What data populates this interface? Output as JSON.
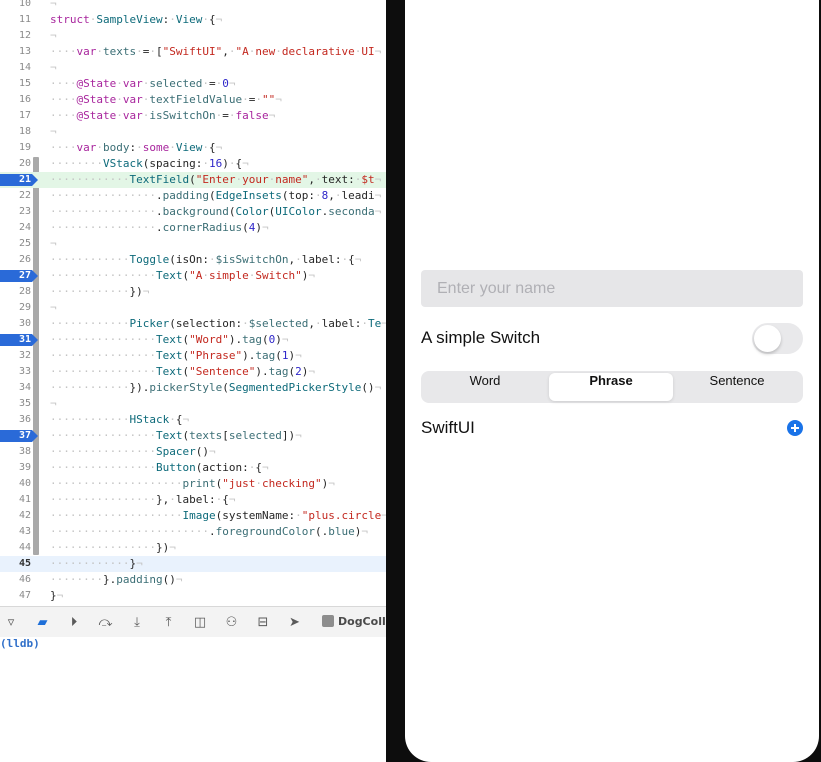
{
  "editor": {
    "lines": [
      {
        "n": "10",
        "code": "",
        "gutter": false,
        "bp": false,
        "hl": ""
      },
      {
        "n": "11",
        "code": "[[kw:struct]]·[[ty:SampleView]]:·[[ty:View]]·{",
        "gutter": false,
        "bp": false,
        "hl": ""
      },
      {
        "n": "12",
        "code": "",
        "gutter": false,
        "bp": false,
        "hl": ""
      },
      {
        "n": "13",
        "code": "····[[kw:var]]·[[fn:texts]]·=·[[[st:\"SwiftUI\"]],·[[st:\"A·new·declarative·UI]]",
        "gutter": false,
        "bp": false,
        "hl": ""
      },
      {
        "n": "14",
        "code": "",
        "gutter": false,
        "bp": false,
        "hl": ""
      },
      {
        "n": "15",
        "code": "····[[kw:@State]]·[[kw:var]]·[[fn:selected]]·=·[[nm:0]]",
        "gutter": false,
        "bp": false,
        "hl": ""
      },
      {
        "n": "16",
        "code": "····[[kw:@State]]·[[kw:var]]·[[fn:textFieldValue]]·=·[[st:\"\"]]",
        "gutter": false,
        "bp": false,
        "hl": ""
      },
      {
        "n": "17",
        "code": "····[[kw:@State]]·[[kw:var]]·[[fn:isSwitchOn]]·=·[[kw:false]]",
        "gutter": false,
        "bp": false,
        "hl": ""
      },
      {
        "n": "18",
        "code": "",
        "gutter": false,
        "bp": false,
        "hl": ""
      },
      {
        "n": "19",
        "code": "····[[kw:var]]·[[fn:body]]:·[[kw:some]]·[[ty:View]]·{",
        "gutter": false,
        "bp": false,
        "hl": ""
      },
      {
        "n": "20",
        "code": "········[[ty:VStack]](spacing:·[[nm:16]])·{",
        "gutter": true,
        "bp": false,
        "hl": ""
      },
      {
        "n": "21",
        "code": "············[[ty:TextField]]([[st:\"Enter·your·name\"]],·text:·[[st:$t]]",
        "gutter": true,
        "bp": true,
        "hl": "sel"
      },
      {
        "n": "22",
        "code": "················.[[fn:padding]]([[ty:EdgeInsets]](top:·[[nm:8]],·leadi",
        "gutter": true,
        "bp": false,
        "hl": ""
      },
      {
        "n": "23",
        "code": "················.[[fn:background]]([[ty:Color]]([[ty:UIColor]].[[fn:seconda]]",
        "gutter": true,
        "bp": false,
        "hl": ""
      },
      {
        "n": "24",
        "code": "················.[[fn:cornerRadius]]([[nm:4]])",
        "gutter": true,
        "bp": false,
        "hl": ""
      },
      {
        "n": "25",
        "code": "",
        "gutter": true,
        "bp": false,
        "hl": ""
      },
      {
        "n": "26",
        "code": "············[[ty:Toggle]](isOn:·[[fn:$isSwitchOn]],·label:·{",
        "gutter": true,
        "bp": false,
        "hl": ""
      },
      {
        "n": "27",
        "code": "················[[ty:Text]]([[st:\"A·simple·Switch\"]])",
        "gutter": true,
        "bp": true,
        "hl": ""
      },
      {
        "n": "28",
        "code": "············})",
        "gutter": true,
        "bp": false,
        "hl": ""
      },
      {
        "n": "29",
        "code": "",
        "gutter": true,
        "bp": false,
        "hl": ""
      },
      {
        "n": "30",
        "code": "············[[ty:Picker]](selection:·[[fn:$selected]],·label:·[[ty:Te]]",
        "gutter": true,
        "bp": false,
        "hl": ""
      },
      {
        "n": "31",
        "code": "················[[ty:Text]]([[st:\"Word\"]]).[[fn:tag]]([[nm:0]])",
        "gutter": true,
        "bp": true,
        "hl": ""
      },
      {
        "n": "32",
        "code": "················[[ty:Text]]([[st:\"Phrase\"]]).[[fn:tag]]([[nm:1]])",
        "gutter": true,
        "bp": false,
        "hl": ""
      },
      {
        "n": "33",
        "code": "················[[ty:Text]]([[st:\"Sentence\"]]).[[fn:tag]]([[nm:2]])",
        "gutter": true,
        "bp": false,
        "hl": ""
      },
      {
        "n": "34",
        "code": "············}).[[fn:pickerStyle]]([[ty:SegmentedPickerStyle]]()",
        "gutter": true,
        "bp": false,
        "hl": ""
      },
      {
        "n": "35",
        "code": "",
        "gutter": true,
        "bp": false,
        "hl": ""
      },
      {
        "n": "36",
        "code": "············[[ty:HStack]]·{",
        "gutter": true,
        "bp": false,
        "hl": ""
      },
      {
        "n": "37",
        "code": "················[[ty:Text]]([[fn:texts]][[[fn:selected]]])",
        "gutter": true,
        "bp": true,
        "hl": ""
      },
      {
        "n": "38",
        "code": "················[[ty:Spacer]]()",
        "gutter": true,
        "bp": false,
        "hl": ""
      },
      {
        "n": "39",
        "code": "················[[ty:Button]](action:·{",
        "gutter": true,
        "bp": false,
        "hl": ""
      },
      {
        "n": "40",
        "code": "····················[[fn:print]]([[st:\"just·checking\"]])",
        "gutter": true,
        "bp": false,
        "hl": ""
      },
      {
        "n": "41",
        "code": "················},·label:·{",
        "gutter": true,
        "bp": false,
        "hl": ""
      },
      {
        "n": "42",
        "code": "····················[[ty:Image]](systemName:·[[st:\"plus.circle]]",
        "gutter": true,
        "bp": false,
        "hl": ""
      },
      {
        "n": "43",
        "code": "························.[[fn:foregroundColor]](.[[fn:blue]])",
        "gutter": true,
        "bp": false,
        "hl": ""
      },
      {
        "n": "44",
        "code": "················})",
        "gutter": true,
        "bp": false,
        "hl": ""
      },
      {
        "n": "45",
        "code": "············}",
        "gutter": false,
        "bp": false,
        "hl": "cur"
      },
      {
        "n": "46",
        "code": "········}.[[fn:padding]]()",
        "gutter": false,
        "bp": false,
        "hl": ""
      },
      {
        "n": "47",
        "code": "}",
        "gutter": false,
        "bp": false,
        "hl": ""
      }
    ]
  },
  "debug_toolbar": {
    "buttons": [
      {
        "name": "hide-console-button",
        "icon": "▿",
        "active": false
      },
      {
        "name": "breakpoints-toggle-button",
        "icon": "▰",
        "active": true
      },
      {
        "name": "continue-button",
        "icon": "⏵",
        "active": false
      },
      {
        "name": "step-over-button",
        "icon": "⤼",
        "active": false
      },
      {
        "name": "step-into-button",
        "icon": "⤓",
        "active": false
      },
      {
        "name": "step-out-button",
        "icon": "⤒",
        "active": false
      },
      {
        "name": "view-hierarchy-button",
        "icon": "◫",
        "active": false
      },
      {
        "name": "memory-graph-button",
        "icon": "⚇",
        "active": false
      },
      {
        "name": "environment-overrides-button",
        "icon": "⊟",
        "active": false
      },
      {
        "name": "simulate-location-button",
        "icon": "➤",
        "active": false
      }
    ],
    "target_label": "DogColle"
  },
  "console": {
    "prompt": "(lldb)"
  },
  "simulator": {
    "text_field_placeholder": "Enter your name",
    "toggle_label": "A simple Switch",
    "toggle_on": false,
    "segments": [
      "Word",
      "Phrase",
      "Sentence"
    ],
    "selected_segment": 1,
    "hstack_text": "SwiftUI",
    "accent_color": "#1a73e8"
  }
}
